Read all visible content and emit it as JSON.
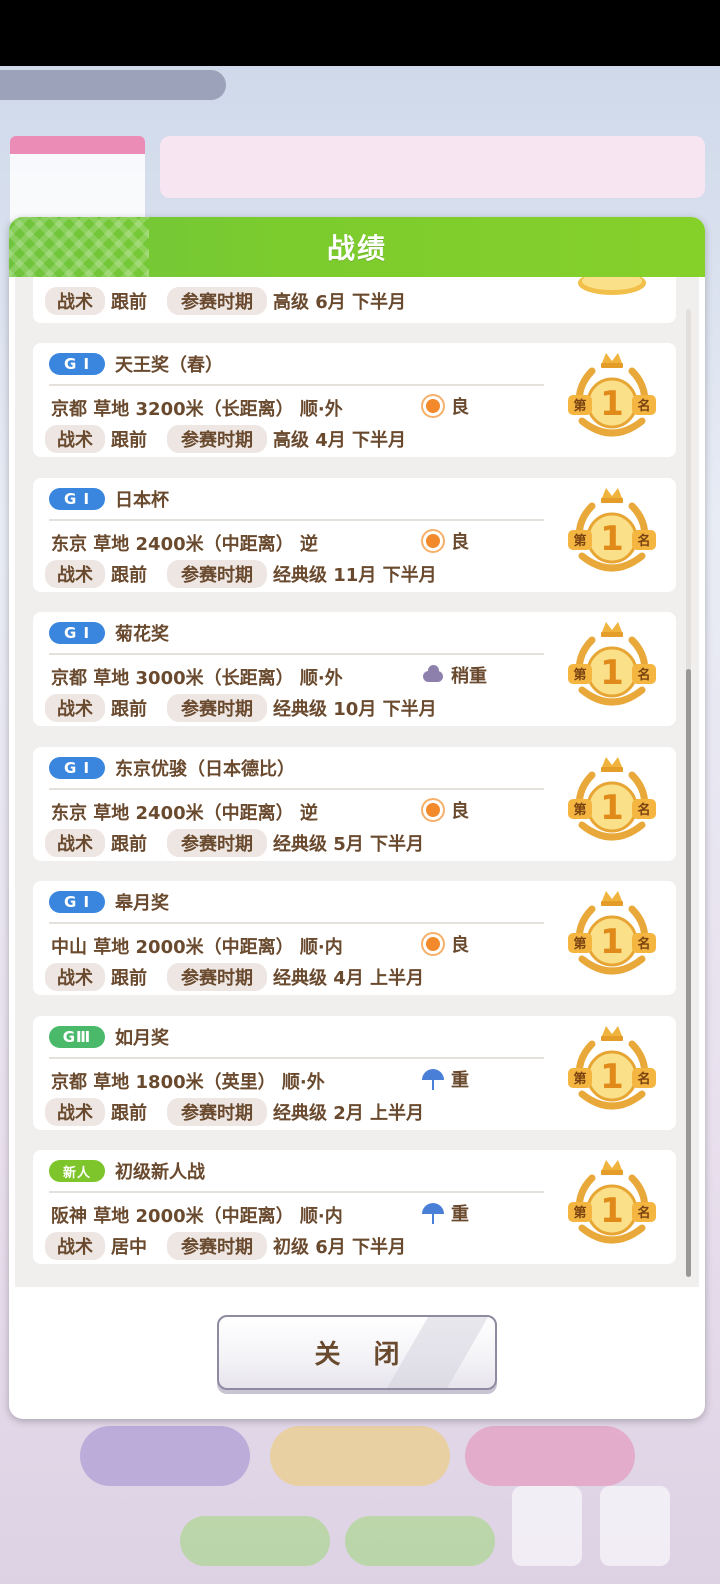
{
  "dialog": {
    "title": "战绩",
    "close_label": "关 闭"
  },
  "labels": {
    "tactic": "战术",
    "period": "参赛时期"
  },
  "partial_row": {
    "tactic": "跟前",
    "period": "高级 6月 下半月"
  },
  "races": [
    {
      "grade": "G I",
      "grade_type": "g1",
      "name": "天王奖（春）",
      "info": "京都 草地 3200米（长距离） 顺·外",
      "weather_icon": "sunny-icon",
      "ground": "良",
      "tactic": "跟前",
      "period": "高级 4月 下半月",
      "result": "第1名"
    },
    {
      "grade": "G I",
      "grade_type": "g1",
      "name": "日本杯",
      "info": "东京 草地 2400米（中距离） 逆",
      "weather_icon": "sunny-icon",
      "ground": "良",
      "tactic": "跟前",
      "period": "经典级 11月 下半月",
      "result": "第1名"
    },
    {
      "grade": "G I",
      "grade_type": "g1",
      "name": "菊花奖",
      "info": "京都 草地 3000米（长距离） 顺·外",
      "weather_icon": "cloudy-icon",
      "ground": "稍重",
      "tactic": "跟前",
      "period": "经典级 10月 下半月",
      "result": "第1名"
    },
    {
      "grade": "G I",
      "grade_type": "g1",
      "name": "东京优骏（日本德比）",
      "info": "东京 草地 2400米（中距离） 逆",
      "weather_icon": "sunny-icon",
      "ground": "良",
      "tactic": "跟前",
      "period": "经典级 5月 下半月",
      "result": "第1名"
    },
    {
      "grade": "G I",
      "grade_type": "g1",
      "name": "皋月奖",
      "info": "中山 草地 2000米（中距离） 顺·内",
      "weather_icon": "sunny-icon",
      "ground": "良",
      "tactic": "跟前",
      "period": "经典级 4月 上半月",
      "result": "第1名"
    },
    {
      "grade": "GⅢ",
      "grade_type": "g3",
      "name": "如月奖",
      "info": "京都 草地 1800米（英里） 顺·外",
      "weather_icon": "rain-icon",
      "ground": "重",
      "tactic": "跟前",
      "period": "经典级 2月 上半月",
      "result": "第1名"
    },
    {
      "grade": "新人",
      "grade_type": "new",
      "name": "初级新人战",
      "info": "阪神 草地 2000米（中距离） 顺·内",
      "weather_icon": "rain-icon",
      "ground": "重",
      "tactic": "居中",
      "period": "初级 6月 下半月",
      "result": "第1名"
    }
  ],
  "colors": {
    "header_green": "#7ccc2e",
    "grade_g1": "#3a86de",
    "grade_g3": "#4ab96a",
    "grade_new": "#7dc52b",
    "text_brown": "#6a4a2e"
  }
}
